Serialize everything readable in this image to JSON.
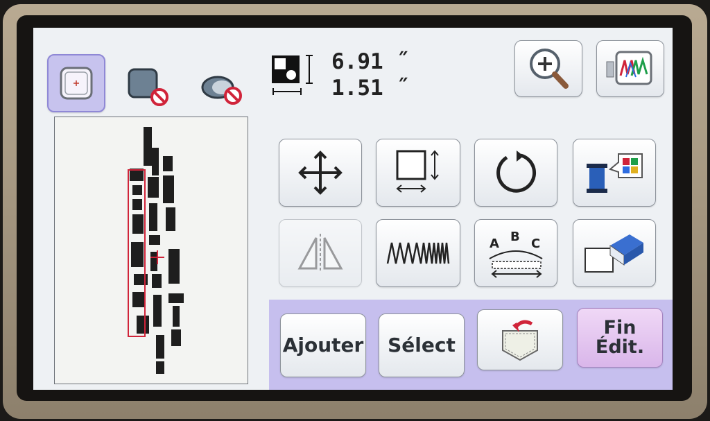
{
  "dimensions": {
    "width": "6.91 ̋",
    "height": "1.51 ̋"
  },
  "buttons": {
    "add": "Ajouter",
    "select": "Sélect",
    "end_edit_line1": "Fin",
    "end_edit_line2": "Édit."
  },
  "icons": {
    "frame_select": "embroidery-frame-icon",
    "no_border": "no-shape-icon",
    "no_oval": "no-oval-icon",
    "pattern_size": "pattern-size-icon",
    "zoom": "zoom-in-icon",
    "stitch_preview": "stitch-preview-icon",
    "move": "move-icon",
    "resize": "resize-icon",
    "rotate": "rotate-icon",
    "thread_color": "thread-color-icon",
    "mirror": "mirror-icon",
    "density": "density-icon",
    "array": "curved-text-icon",
    "border": "border-eraser-icon",
    "pocket": "pocket-icon"
  },
  "colors": {
    "selected": "#c7c3ee",
    "bottom_bar": "#c6bfee",
    "accent_red": "#d0243a"
  }
}
